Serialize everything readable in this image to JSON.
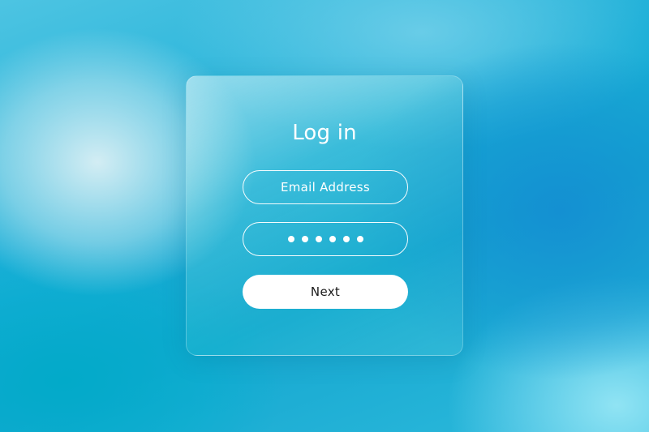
{
  "login": {
    "title": "Log in",
    "email_placeholder": "Email Address",
    "password_mask_count": 6,
    "next_label": "Next"
  },
  "colors": {
    "background_primary": "#14a6cf",
    "background_light": "#dcf0f5",
    "card_tint": "#5fd0e0",
    "text": "#ffffff",
    "button_bg": "#ffffff",
    "button_text": "#1a1a1a"
  }
}
